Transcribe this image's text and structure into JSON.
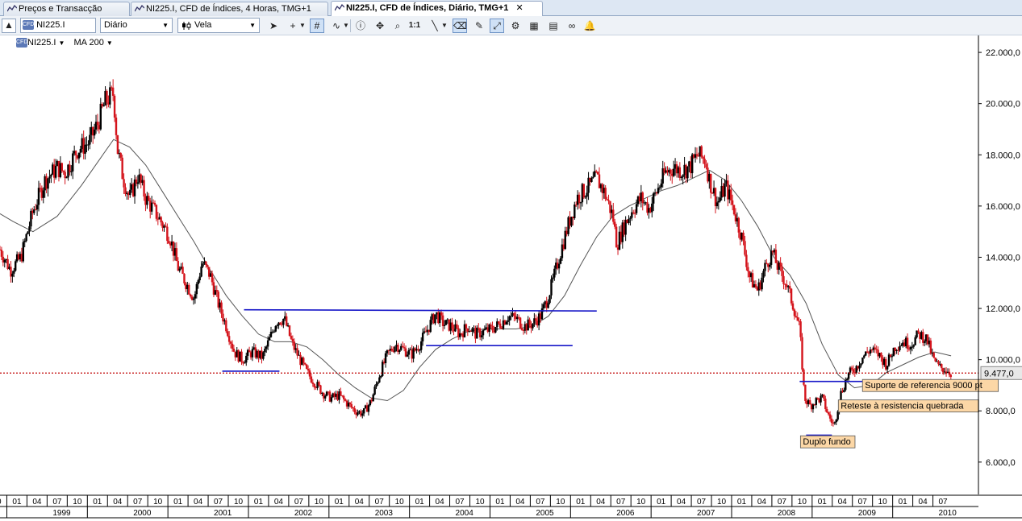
{
  "tabs": [
    {
      "label": "Preços e Transacção",
      "active": false
    },
    {
      "label": "NI225.I, CFD de Índices, 4 Horas, TMG+1",
      "active": false
    },
    {
      "label": "NI225.I, CFD de Índices, Diário, TMG+1",
      "active": true
    }
  ],
  "toolbar": {
    "symbol_badge": "CFD",
    "symbol": "NI225.I",
    "timeframe": "Diário",
    "chart_type": "Vela",
    "one_to_one": "1:1"
  },
  "legend": {
    "symbol": "NI225.I",
    "indicator": "MA 200"
  },
  "colors": {
    "candle_up": "#000000",
    "candle_down": "#d4141c",
    "moving_average": "#555555",
    "trendline": "#1616c8",
    "price_line": "#c00000",
    "annotation_bg": "#fcd7a6"
  },
  "chart_data": {
    "type": "candlestick",
    "instrument": "NI225.I",
    "timeframe": "Diário",
    "ylim": [
      4800,
      22600
    ],
    "yticks": [
      6000,
      8000,
      10000,
      12000,
      14000,
      16000,
      18000,
      20000,
      22000
    ],
    "ytick_labels": [
      "6.000,0",
      "8.000,0",
      "10.000,0",
      "12.000,0",
      "14.000,0",
      "16.000,0",
      "18.000,0",
      "20.000,0",
      "22.000,0"
    ],
    "xlim": [
      1998.79,
      2010.94
    ],
    "current_price": 9477,
    "current_price_label": "9.477,0",
    "month_labels": [
      "10",
      "01",
      "04",
      "07",
      "10",
      "01",
      "04",
      "07",
      "10",
      "01",
      "04",
      "07",
      "10",
      "01",
      "04",
      "07",
      "10",
      "01",
      "04",
      "07",
      "10",
      "01",
      "04",
      "07",
      "10",
      "01",
      "04",
      "07",
      "10",
      "01",
      "04",
      "07",
      "10",
      "01",
      "04",
      "07",
      "10",
      "01",
      "04",
      "07",
      "10",
      "01",
      "04",
      "07",
      "10",
      "01",
      "04",
      "07"
    ],
    "month_positions": [
      1998.75,
      1999.0,
      1999.25,
      1999.5,
      1999.75,
      2000.0,
      2000.25,
      2000.5,
      2000.75,
      2001.0,
      2001.25,
      2001.5,
      2001.75,
      2002.0,
      2002.25,
      2002.5,
      2002.75,
      2003.0,
      2003.25,
      2003.5,
      2003.75,
      2004.0,
      2004.25,
      2004.5,
      2004.75,
      2005.0,
      2005.25,
      2005.5,
      2005.75,
      2006.0,
      2006.25,
      2006.5,
      2006.75,
      2007.0,
      2007.25,
      2007.5,
      2007.75,
      2008.0,
      2008.25,
      2008.5,
      2008.75,
      2009.0,
      2009.25,
      2009.5,
      2009.75,
      2010.0,
      2010.25,
      2010.5
    ],
    "year_labels": [
      "1999",
      "2000",
      "2001",
      "2002",
      "2003",
      "2004",
      "2005",
      "2006",
      "2007",
      "2008",
      "2009",
      "2010"
    ],
    "price_path": [
      [
        1998.79,
        14300
      ],
      [
        1998.92,
        13500
      ],
      [
        1999.05,
        14000
      ],
      [
        1999.2,
        15800
      ],
      [
        1999.35,
        17000
      ],
      [
        1999.5,
        17500
      ],
      [
        1999.6,
        17300
      ],
      [
        1999.75,
        18200
      ],
      [
        1999.9,
        18500
      ],
      [
        2000.0,
        19200
      ],
      [
        2000.1,
        20100
      ],
      [
        2000.2,
        20400
      ],
      [
        2000.25,
        18200
      ],
      [
        2000.32,
        17100
      ],
      [
        2000.4,
        16300
      ],
      [
        2000.5,
        17200
      ],
      [
        2000.6,
        16300
      ],
      [
        2000.75,
        15600
      ],
      [
        2000.9,
        14800
      ],
      [
        2001.0,
        13600
      ],
      [
        2001.1,
        13000
      ],
      [
        2001.2,
        12400
      ],
      [
        2001.3,
        13800
      ],
      [
        2001.4,
        13300
      ],
      [
        2001.5,
        12200
      ],
      [
        2001.6,
        11300
      ],
      [
        2001.7,
        10300
      ],
      [
        2001.8,
        10000
      ],
      [
        2001.92,
        10300
      ],
      [
        2002.05,
        10100
      ],
      [
        2002.15,
        10900
      ],
      [
        2002.22,
        11500
      ],
      [
        2002.32,
        11600
      ],
      [
        2002.42,
        10600
      ],
      [
        2002.5,
        10100
      ],
      [
        2002.6,
        9500
      ],
      [
        2002.7,
        9100
      ],
      [
        2002.8,
        8700
      ],
      [
        2002.9,
        8500
      ],
      [
        2003.0,
        8600
      ],
      [
        2003.1,
        8300
      ],
      [
        2003.2,
        8000
      ],
      [
        2003.3,
        7900
      ],
      [
        2003.4,
        8400
      ],
      [
        2003.5,
        9400
      ],
      [
        2003.6,
        10200
      ],
      [
        2003.7,
        10600
      ],
      [
        2003.8,
        10400
      ],
      [
        2003.9,
        10200
      ],
      [
        2004.0,
        10600
      ],
      [
        2004.1,
        11200
      ],
      [
        2004.2,
        11800
      ],
      [
        2004.3,
        11400
      ],
      [
        2004.4,
        11300
      ],
      [
        2004.5,
        11000
      ],
      [
        2004.6,
        11300
      ],
      [
        2004.7,
        11000
      ],
      [
        2004.8,
        11100
      ],
      [
        2004.9,
        11200
      ],
      [
        2005.0,
        11400
      ],
      [
        2005.1,
        11700
      ],
      [
        2005.2,
        11600
      ],
      [
        2005.3,
        11300
      ],
      [
        2005.4,
        11400
      ],
      [
        2005.5,
        11700
      ],
      [
        2005.58,
        12300
      ],
      [
        2005.65,
        13000
      ],
      [
        2005.75,
        14200
      ],
      [
        2005.85,
        15300
      ],
      [
        2005.95,
        16300
      ],
      [
        2006.05,
        16600
      ],
      [
        2006.12,
        16800
      ],
      [
        2006.2,
        17100
      ],
      [
        2006.3,
        16500
      ],
      [
        2006.4,
        15600
      ],
      [
        2006.45,
        14500
      ],
      [
        2006.55,
        15300
      ],
      [
        2006.65,
        15900
      ],
      [
        2006.75,
        16300
      ],
      [
        2006.85,
        15900
      ],
      [
        2006.95,
        16600
      ],
      [
        2007.05,
        17300
      ],
      [
        2007.15,
        17500
      ],
      [
        2007.25,
        17400
      ],
      [
        2007.35,
        17500
      ],
      [
        2007.45,
        18000
      ],
      [
        2007.55,
        17800
      ],
      [
        2007.6,
        17000
      ],
      [
        2007.7,
        16100
      ],
      [
        2007.8,
        16800
      ],
      [
        2007.9,
        15900
      ],
      [
        2008.0,
        14800
      ],
      [
        2008.1,
        13200
      ],
      [
        2008.2,
        12700
      ],
      [
        2008.3,
        13700
      ],
      [
        2008.38,
        14200
      ],
      [
        2008.45,
        13600
      ],
      [
        2008.55,
        13000
      ],
      [
        2008.65,
        12000
      ],
      [
        2008.72,
        11200
      ],
      [
        2008.78,
        8500
      ],
      [
        2008.85,
        8200
      ],
      [
        2008.92,
        8400
      ],
      [
        2009.0,
        8500
      ],
      [
        2009.08,
        7800
      ],
      [
        2009.15,
        7400
      ],
      [
        2009.22,
        8600
      ],
      [
        2009.32,
        9400
      ],
      [
        2009.42,
        9700
      ],
      [
        2009.5,
        10100
      ],
      [
        2009.6,
        10400
      ],
      [
        2009.7,
        10200
      ],
      [
        2009.8,
        9800
      ],
      [
        2009.9,
        10500
      ],
      [
        2010.0,
        10700
      ],
      [
        2010.1,
        10600
      ],
      [
        2010.2,
        11000
      ],
      [
        2010.3,
        10800
      ],
      [
        2010.38,
        10000
      ],
      [
        2010.45,
        9700
      ],
      [
        2010.55,
        9600
      ],
      [
        2010.6,
        9477
      ]
    ],
    "moving_average_path": [
      [
        1998.79,
        15700
      ],
      [
        1998.95,
        15400
      ],
      [
        1999.2,
        15000
      ],
      [
        1999.5,
        15600
      ],
      [
        1999.8,
        16800
      ],
      [
        2000.0,
        17700
      ],
      [
        2000.2,
        18600
      ],
      [
        2000.4,
        18300
      ],
      [
        2000.6,
        17600
      ],
      [
        2000.8,
        16600
      ],
      [
        2001.0,
        15600
      ],
      [
        2001.2,
        14600
      ],
      [
        2001.4,
        13500
      ],
      [
        2001.6,
        12500
      ],
      [
        2001.8,
        11700
      ],
      [
        2002.0,
        11000
      ],
      [
        2002.2,
        10700
      ],
      [
        2002.4,
        10700
      ],
      [
        2002.6,
        10500
      ],
      [
        2002.8,
        10000
      ],
      [
        2003.0,
        9400
      ],
      [
        2003.2,
        8900
      ],
      [
        2003.4,
        8500
      ],
      [
        2003.6,
        8400
      ],
      [
        2003.8,
        8800
      ],
      [
        2004.0,
        9700
      ],
      [
        2004.2,
        10400
      ],
      [
        2004.4,
        10800
      ],
      [
        2004.6,
        11100
      ],
      [
        2004.8,
        11200
      ],
      [
        2005.0,
        11200
      ],
      [
        2005.2,
        11200
      ],
      [
        2005.4,
        11300
      ],
      [
        2005.6,
        11700
      ],
      [
        2005.8,
        12500
      ],
      [
        2006.0,
        13700
      ],
      [
        2006.2,
        14800
      ],
      [
        2006.4,
        15600
      ],
      [
        2006.6,
        16000
      ],
      [
        2006.8,
        16300
      ],
      [
        2007.0,
        16600
      ],
      [
        2007.2,
        16800
      ],
      [
        2007.4,
        17100
      ],
      [
        2007.6,
        17400
      ],
      [
        2007.8,
        17000
      ],
      [
        2008.0,
        16200
      ],
      [
        2008.2,
        15200
      ],
      [
        2008.4,
        14000
      ],
      [
        2008.6,
        13300
      ],
      [
        2008.8,
        12200
      ],
      [
        2009.0,
        10600
      ],
      [
        2009.2,
        9400
      ],
      [
        2009.4,
        8900
      ],
      [
        2009.6,
        9000
      ],
      [
        2009.8,
        9500
      ],
      [
        2010.0,
        9800
      ],
      [
        2010.2,
        10100
      ],
      [
        2010.4,
        10300
      ],
      [
        2010.6,
        10150
      ]
    ],
    "trendlines": [
      {
        "x1": 2001.55,
        "y1": 9550,
        "x2": 2002.26,
        "y2": 9550
      },
      {
        "x1": 2001.82,
        "y1": 11950,
        "x2": 2006.2,
        "y2": 11900
      },
      {
        "x1": 2004.08,
        "y1": 10550,
        "x2": 2005.9,
        "y2": 10550
      },
      {
        "x1": 2008.72,
        "y1": 9150,
        "x2": 2010.8,
        "y2": 9150
      },
      {
        "x1": 2008.8,
        "y1": 7050,
        "x2": 2009.12,
        "y2": 7050
      }
    ],
    "annotations": [
      {
        "text": "Suporte de referencia 9000 pt",
        "x": 2009.5,
        "y": 8850
      },
      {
        "text": "Reteste à resistencia quebrada",
        "x": 2009.2,
        "y": 8050
      },
      {
        "text": "Duplo fundo",
        "x": 2008.73,
        "y": 6650
      }
    ]
  }
}
